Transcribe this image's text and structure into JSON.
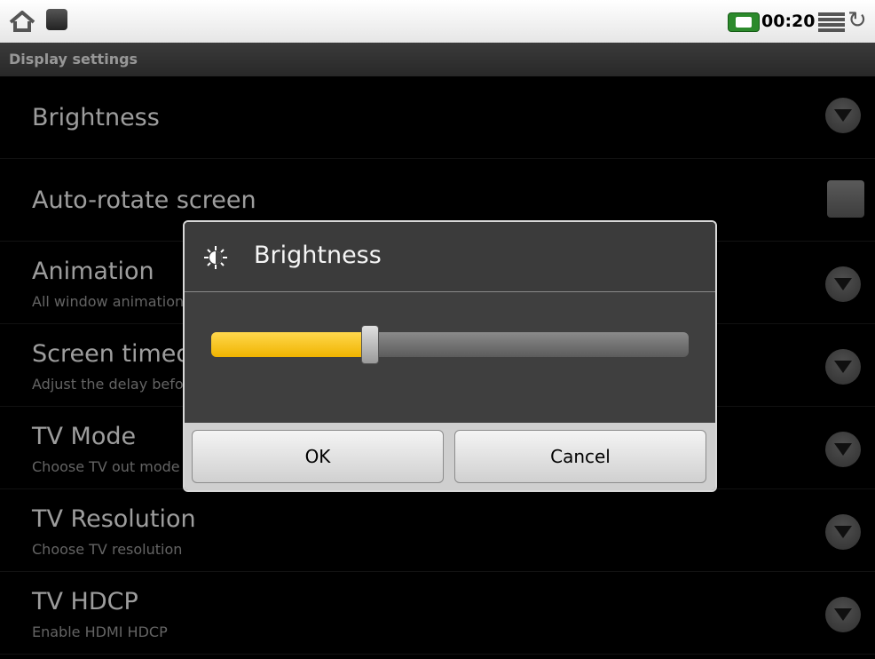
{
  "status_bar": {
    "time": "00:20",
    "icons": [
      "home-icon",
      "android-debug-icon",
      "battery-charging-icon",
      "notification-list-icon",
      "sync-icon"
    ]
  },
  "screen": {
    "title": "Display settings"
  },
  "settings": [
    {
      "title": "Brightness",
      "summary": "",
      "control": "dropdown-arrow"
    },
    {
      "title": "Auto-rotate screen",
      "summary": "",
      "control": "checkbox"
    },
    {
      "title": "Animation",
      "summary": "All window animations are shown",
      "control": "dropdown-arrow"
    },
    {
      "title": "Screen timeout",
      "summary": "Adjust the delay before the screen automatically turns off",
      "control": "dropdown-arrow"
    },
    {
      "title": "TV Mode",
      "summary": "Choose TV out mode",
      "control": "dropdown-arrow"
    },
    {
      "title": "TV Resolution",
      "summary": "Choose TV resolution",
      "control": "dropdown-arrow"
    },
    {
      "title": "TV HDCP",
      "summary": "Enable HDMI HDCP",
      "control": "dropdown-arrow"
    }
  ],
  "dialog": {
    "title": "Brightness",
    "icon": "brightness-icon",
    "slider_fraction": 0.33,
    "ok_label": "OK",
    "cancel_label": "Cancel"
  },
  "colors": {
    "accent": "#f5b800",
    "background": "#000000"
  }
}
